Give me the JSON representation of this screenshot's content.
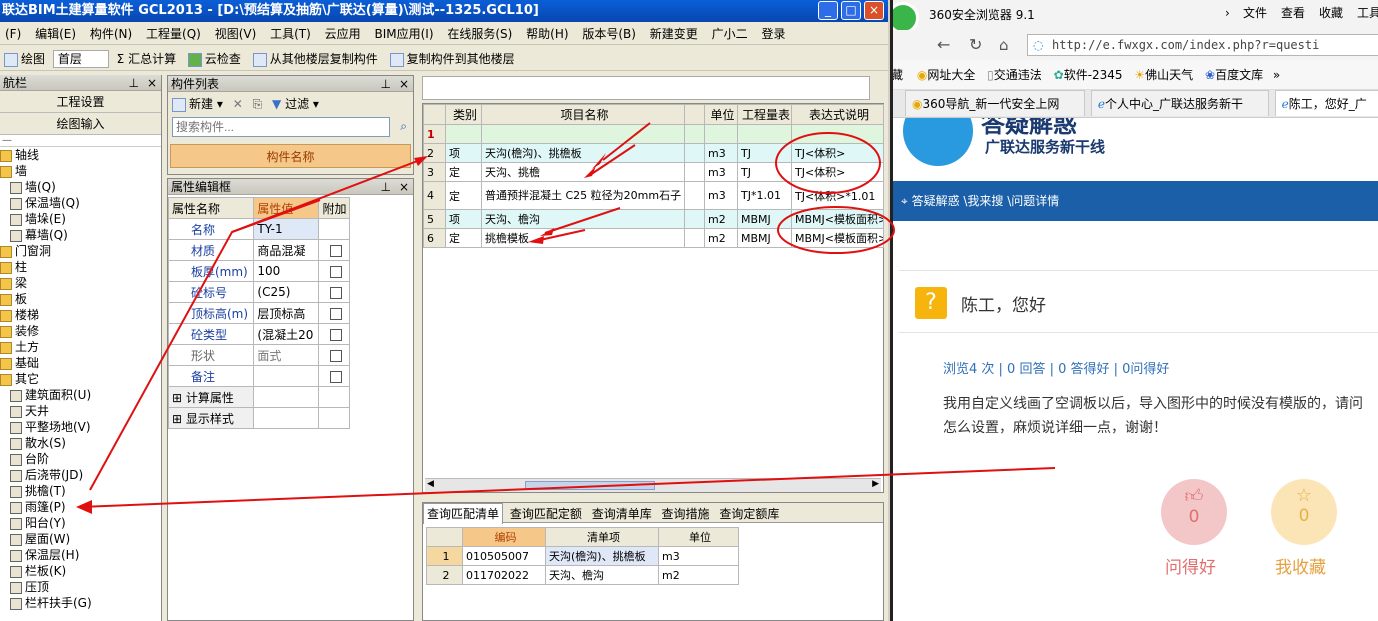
{
  "gcl": {
    "title": "联达BIM土建算量软件 GCL2013 - [D:\\预结算及抽筋\\广联达(算量)\\测试--1325.GCL10]",
    "win_buttons": [
      "_",
      "□",
      "×"
    ],
    "menu": [
      "(F)",
      "编辑(E)",
      "构件(N)",
      "工程量(Q)",
      "视图(V)",
      "工具(T)",
      "云应用",
      "BIM应用(I)",
      "在线服务(S)",
      "帮助(H)",
      "版本号(B)",
      "新建变更",
      "广小二",
      "登录"
    ],
    "toolbar": [
      "绘图",
      "首层",
      "Σ 汇总计算",
      "云检查",
      "从其他楼层复制构件",
      "复制构件到其他楼层"
    ],
    "nav": {
      "title": "航栏",
      "buttons": [
        "工程设置",
        "绘图输入"
      ],
      "tree": [
        {
          "label": "轴线",
          "level": 0
        },
        {
          "label": "墙",
          "level": 0
        },
        {
          "label": "墙(Q)",
          "level": 1
        },
        {
          "label": "保温墙(Q)",
          "level": 1
        },
        {
          "label": "墙垛(E)",
          "level": 1
        },
        {
          "label": "幕墙(Q)",
          "level": 1
        },
        {
          "label": "门窗洞",
          "level": 0
        },
        {
          "label": "柱",
          "level": 0
        },
        {
          "label": "梁",
          "level": 0
        },
        {
          "label": "板",
          "level": 0
        },
        {
          "label": "楼梯",
          "level": 0
        },
        {
          "label": "装修",
          "level": 0
        },
        {
          "label": "土方",
          "level": 0
        },
        {
          "label": "基础",
          "level": 0
        },
        {
          "label": "其它",
          "level": 0
        },
        {
          "label": "建筑面积(U)",
          "level": 1
        },
        {
          "label": "天井",
          "level": 1
        },
        {
          "label": "平整场地(V)",
          "level": 1
        },
        {
          "label": "散水(S)",
          "level": 1
        },
        {
          "label": "台阶",
          "level": 1
        },
        {
          "label": "后浇带(JD)",
          "level": 1
        },
        {
          "label": "挑檐(T)",
          "level": 1
        },
        {
          "label": "雨篷(P)",
          "level": 1
        },
        {
          "label": "阳台(Y)",
          "level": 1
        },
        {
          "label": "屋面(W)",
          "level": 1
        },
        {
          "label": "保温层(H)",
          "level": 1
        },
        {
          "label": "栏板(K)",
          "level": 1
        },
        {
          "label": "压顶",
          "level": 1
        },
        {
          "label": "栏杆扶手(G)",
          "level": 1
        }
      ]
    },
    "complist": {
      "title": "构件列表",
      "new_label": "新建",
      "filter_label": "过滤",
      "search_placeholder": "搜索构件...",
      "col_header": "构件名称"
    },
    "propedit": {
      "title": "属性编辑框",
      "headers": [
        "属性名称",
        "属性值",
        "附加"
      ],
      "rows": [
        {
          "name": "名称",
          "value": "TY-1",
          "check": false
        },
        {
          "name": "材质",
          "value": "商品混凝",
          "check": true
        },
        {
          "name": "板厚(mm)",
          "value": "100",
          "check": true
        },
        {
          "name": "砼标号",
          "value": "(C25)",
          "check": true
        },
        {
          "name": "顶标高(m)",
          "value": "层顶标高",
          "check": true
        },
        {
          "name": "砼类型",
          "value": "(混凝土20",
          "check": true
        },
        {
          "name": "形状",
          "value": "面式",
          "check": true
        },
        {
          "name": "备注",
          "value": "",
          "check": true
        },
        {
          "name": "⊞ 计算属性",
          "value": "",
          "check": false
        },
        {
          "name": "⊞ 显示样式",
          "value": "",
          "check": false
        }
      ]
    },
    "grid": {
      "headers": [
        "",
        "类别",
        "项目名称",
        "",
        "单位",
        "工程量表",
        "表达式说明"
      ],
      "rows": [
        {
          "num": "1",
          "cat": "",
          "name": "",
          "unit": "",
          "qty": "",
          "expr": ""
        },
        {
          "num": "2",
          "cat": "项",
          "name": "天沟(檐沟)、挑檐板",
          "unit": "m3",
          "qty": "TJ",
          "expr": "TJ<体积>"
        },
        {
          "num": "3",
          "cat": "定",
          "name": "天沟、挑檐",
          "unit": "m3",
          "qty": "TJ",
          "expr": "TJ<体积>"
        },
        {
          "num": "4",
          "cat": "定",
          "name": "普通预拌混凝土 C25 粒径为20mm石子",
          "unit": "m3",
          "qty": "TJ*1.01",
          "expr": "TJ<体积>*1.01"
        },
        {
          "num": "5",
          "cat": "项",
          "name": "天沟、檐沟",
          "unit": "m2",
          "qty": "MBMJ",
          "expr": "MBMJ<模板面积>"
        },
        {
          "num": "6",
          "cat": "定",
          "name": "挑檐模板",
          "unit": "m2",
          "qty": "MBMJ",
          "expr": "MBMJ<模板面积>"
        }
      ]
    },
    "bottom": {
      "tabs": [
        "查询匹配清单",
        "查询匹配定额",
        "查询清单库",
        "查询措施",
        "查询定额库"
      ],
      "headers": [
        "",
        "编码",
        "清单项",
        "单位"
      ],
      "rows": [
        {
          "num": "1",
          "code": "010505007",
          "item": "天沟(檐沟)、挑檐板",
          "unit": "m3"
        },
        {
          "num": "2",
          "code": "011702022",
          "item": "天沟、檐沟",
          "unit": "m2"
        }
      ]
    }
  },
  "browser": {
    "title": "360安全浏览器 9.1",
    "menu": [
      "文件",
      "查看",
      "收藏",
      "工具"
    ],
    "url": "http://e.fwxgx.com/index.php?r=questi",
    "favorites": [
      "藏",
      "网址大全",
      "交通违法",
      "软件-2345",
      "佛山天气",
      "百度文库",
      "»"
    ],
    "tabs": [
      "360导航_新一代安全上网",
      "个人中心_广联达服务新干",
      "陈工，您好_广"
    ],
    "banner_title": "答疑解惑",
    "banner_sub": "广联达服务新干线",
    "breadcrumb": "答疑解惑 \\我来搜 \\问题详情",
    "question_title": "陈工，您好",
    "stats": "浏览4 次 | 0 回答 | 0 答得好 | 0问得好",
    "question_body": "我用自定义线画了空调板以后，导入图形中的时候没有模版的，请问怎么设置，麻烦说详细一点，谢谢！",
    "like_count": "0",
    "like_label": "问得好",
    "fav_count": "0",
    "fav_label": "我收藏",
    "colors": {
      "blue": "#1a5fa8",
      "like": "#f3c7c7",
      "fav": "#fbe5b6"
    }
  }
}
